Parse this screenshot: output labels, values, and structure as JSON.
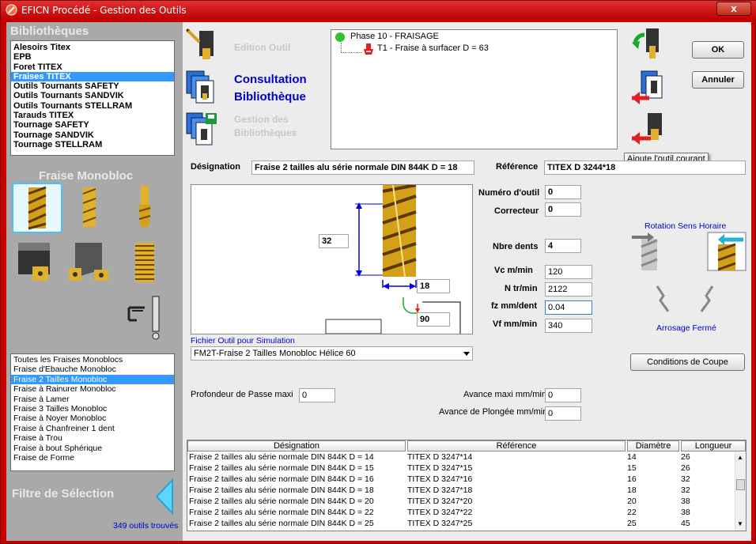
{
  "window": {
    "title": "EFICN Procédé - Gestion des Outils",
    "close_label": "x"
  },
  "left": {
    "libraries_title": "Bibliothèques",
    "libraries": [
      "Alesoirs Titex",
      "EPB",
      "Foret TITEX",
      "Fraises TITEX",
      "Outils Tournants SAFETY",
      "Outils Tournants SANDVIK",
      "Outils Tournants STELLRAM",
      "Tarauds TITEX",
      "Tournage  SAFETY",
      "Tournage SANDVIK",
      "Tournage STELLRAM"
    ],
    "libraries_selected": 3,
    "family_title": "Fraise Monobloc",
    "subtypes": [
      "Toutes les Fraises Monoblocs",
      "Fraise d'Ebauche Monobloc",
      "Fraise 2 Tailles Monobloc",
      "Fraise à Rainurer Monobloc",
      "Fraise à Lamer",
      "Fraise 3 Tailles Monobloc",
      "Fraise à Noyer Monobloc",
      "Fraise à Chanfreiner 1 dent",
      "Fraise à Trou",
      "Fraise à bout Sphérique",
      "Fraise de Forme"
    ],
    "subtypes_selected": 2,
    "filter_title": "Filtre de Sélection",
    "count": "349 outils trouvés"
  },
  "modes": {
    "edit": "Edition Outil",
    "consult_line1": "Consultation",
    "consult_line2": "Bibliothèque",
    "manage_line1": "Gestion des",
    "manage_line2": "Bibliothèques"
  },
  "tree": {
    "phase": "Phase 10 - FRAISAGE",
    "tool": "T1 - Fraise à surfacer D = 63"
  },
  "buttons": {
    "ok": "OK",
    "cancel": "Annuler",
    "cutting": "Conditions de Coupe"
  },
  "tooltip": "Ajoute l'outil courant",
  "form": {
    "designation_label": "Désignation",
    "designation": "Fraise 2 tailles alu série normale DIN 844K D = 18",
    "reference_label": "Référence",
    "reference": "TITEX D 3244*18",
    "tool_number_label": "Numéro d'outil",
    "tool_number": "0",
    "corrector_label": "Correcteur",
    "corrector": "0",
    "teeth_label": "Nbre dents",
    "teeth": "4",
    "vc_label": "Vc m/min",
    "vc": "120",
    "n_label": "N tr/min",
    "n": "2122",
    "fz_label": "fz mm/dent",
    "fz": "0.04",
    "vf_label": "Vf mm/min",
    "vf": "340",
    "length_val": "32",
    "diameter_val": "18",
    "angle_val": "90",
    "sim_label": "Fichier Outil pour Simulation",
    "sim_file": "FM2T-Fraise 2 Tailles Monobloc Hélice 60",
    "rotation": "Rotation Sens Horaire",
    "coolant": "Arrosage Fermé",
    "depth_label": "Profondeur de Passe maxi",
    "depth": "0",
    "feed_max_label": "Avance maxi mm/min",
    "feed_max": "0",
    "plunge_label": "Avance de Plongée mm/min",
    "plunge": "0"
  },
  "table": {
    "headers": [
      "Désignation",
      "Référence",
      "Diamètre",
      "Longueur"
    ],
    "rows": [
      [
        "Fraise 2 tailles alu série normale DIN 844K D = 14",
        "TITEX D 3247*14",
        "14",
        "26"
      ],
      [
        "Fraise 2 tailles alu série normale DIN 844K D = 15",
        "TITEX D 3247*15",
        "15",
        "26"
      ],
      [
        "Fraise 2 tailles alu série normale DIN 844K D = 16",
        "TITEX D 3247*16",
        "16",
        "32"
      ],
      [
        "Fraise 2 tailles alu série normale DIN 844K D = 18",
        "TITEX D 3247*18",
        "18",
        "32"
      ],
      [
        "Fraise 2 tailles alu série normale DIN 844K D = 20",
        "TITEX D 3247*20",
        "20",
        "38"
      ],
      [
        "Fraise 2 tailles alu série normale DIN 844K D = 22",
        "TITEX D 3247*22",
        "22",
        "38"
      ],
      [
        "Fraise 2 tailles alu série normale DIN 844K D = 25",
        "TITEX D 3247*25",
        "25",
        "45"
      ]
    ]
  },
  "colors": {
    "title_bar": "#c80000",
    "selection": "#3399ff",
    "accent_blue": "#0000cc",
    "tool_gold": "#d4a017"
  }
}
